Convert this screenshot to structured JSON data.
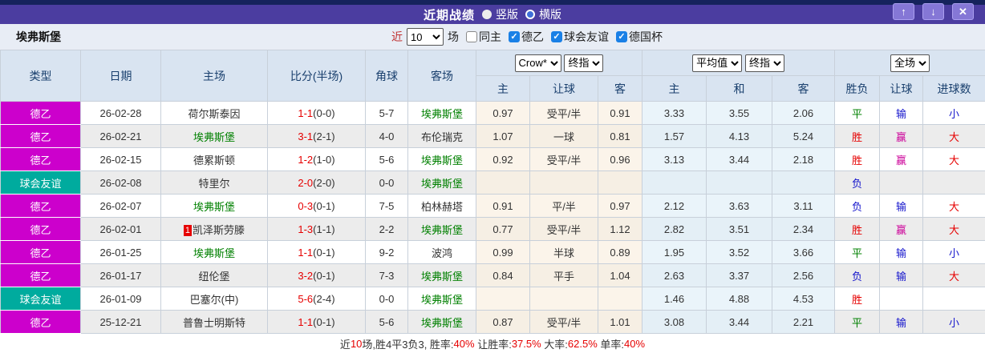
{
  "colors": {
    "red": "#e60000",
    "blue": "#1515cc",
    "green": "#008000",
    "magenta": "#cc0099",
    "badge_de2": "#cc00cc",
    "badge_friendly": "#00ab9e"
  },
  "title_bar": {
    "title": "近期战绩",
    "radio_vertical": "竖版",
    "radio_horizontal": "横版",
    "selected": "竖版",
    "buttons": {
      "up": "↑",
      "down": "↓",
      "close": "✕"
    }
  },
  "filter_bar": {
    "team": "埃弗斯堡",
    "recent_label": "近",
    "recent_value": "10",
    "games_label": "场",
    "checkboxes": [
      {
        "label": "同主",
        "checked": false
      },
      {
        "label": "德乙",
        "checked": true
      },
      {
        "label": "球会友谊",
        "checked": true
      },
      {
        "label": "德国杯",
        "checked": true
      }
    ]
  },
  "table": {
    "top_headers": [
      "类型",
      "日期",
      "主场",
      "比分(半场)",
      "角球",
      "客场"
    ],
    "sub_headers": [
      "主",
      "让球",
      "客",
      "主",
      "和",
      "客",
      "胜负",
      "让球",
      "进球数"
    ],
    "selects": {
      "handicap_company": "Crow*",
      "handicap_index": "终指",
      "odds_company": "平均值",
      "odds_index": "终指",
      "scope": "全场"
    },
    "rows": [
      {
        "type": "德乙",
        "type_key": "de2",
        "date": "26-02-28",
        "rank": "",
        "home": "荷尔斯泰因",
        "home_green": false,
        "ft": "1-1",
        "ht": "(0-0)",
        "corner": "5-7",
        "away": "埃弗斯堡",
        "away_green": true,
        "h_home": "0.97",
        "h_line": "受平/半",
        "h_away": "0.91",
        "a_home": "3.33",
        "a_draw": "3.55",
        "a_away": "2.06",
        "result": "平",
        "result_key": "green",
        "handicap": "输",
        "handicap_key": "blue",
        "goals": "小",
        "goals_key": "blue"
      },
      {
        "type": "德乙",
        "type_key": "de2",
        "date": "26-02-21",
        "rank": "",
        "home": "埃弗斯堡",
        "home_green": true,
        "ft": "3-1",
        "ht": "(2-1)",
        "corner": "4-0",
        "away": "布伦瑞克",
        "away_green": false,
        "h_home": "1.07",
        "h_line": "一球",
        "h_away": "0.81",
        "a_home": "1.57",
        "a_draw": "4.13",
        "a_away": "5.24",
        "result": "胜",
        "result_key": "red",
        "handicap": "赢",
        "handicap_key": "magenta",
        "goals": "大",
        "goals_key": "red"
      },
      {
        "type": "德乙",
        "type_key": "de2",
        "date": "26-02-15",
        "rank": "",
        "home": "德累斯顿",
        "home_green": false,
        "ft": "1-2",
        "ht": "(1-0)",
        "corner": "5-6",
        "away": "埃弗斯堡",
        "away_green": true,
        "h_home": "0.92",
        "h_line": "受平/半",
        "h_away": "0.96",
        "a_home": "3.13",
        "a_draw": "3.44",
        "a_away": "2.18",
        "result": "胜",
        "result_key": "red",
        "handicap": "赢",
        "handicap_key": "magenta",
        "goals": "大",
        "goals_key": "red"
      },
      {
        "type": "球会友谊",
        "type_key": "friendly",
        "date": "26-02-08",
        "rank": "",
        "home": "特里尔",
        "home_green": false,
        "ft": "2-0",
        "ht": "(2-0)",
        "corner": "0-0",
        "away": "埃弗斯堡",
        "away_green": true,
        "h_home": "",
        "h_line": "",
        "h_away": "",
        "a_home": "",
        "a_draw": "",
        "a_away": "",
        "result": "负",
        "result_key": "blue",
        "handicap": "",
        "handicap_key": "blue",
        "goals": "",
        "goals_key": "blue"
      },
      {
        "type": "德乙",
        "type_key": "de2",
        "date": "26-02-07",
        "rank": "",
        "home": "埃弗斯堡",
        "home_green": true,
        "ft": "0-3",
        "ht": "(0-1)",
        "corner": "7-5",
        "away": "柏林赫塔",
        "away_green": false,
        "h_home": "0.91",
        "h_line": "平/半",
        "h_away": "0.97",
        "a_home": "2.12",
        "a_draw": "3.63",
        "a_away": "3.11",
        "result": "负",
        "result_key": "blue",
        "handicap": "输",
        "handicap_key": "blue",
        "goals": "大",
        "goals_key": "red"
      },
      {
        "type": "德乙",
        "type_key": "de2",
        "date": "26-02-01",
        "rank": "1",
        "home": "凯泽斯劳滕",
        "home_green": false,
        "ft": "1-3",
        "ht": "(1-1)",
        "corner": "2-2",
        "away": "埃弗斯堡",
        "away_green": true,
        "h_home": "0.77",
        "h_line": "受平/半",
        "h_away": "1.12",
        "a_home": "2.82",
        "a_draw": "3.51",
        "a_away": "2.34",
        "result": "胜",
        "result_key": "red",
        "handicap": "赢",
        "handicap_key": "magenta",
        "goals": "大",
        "goals_key": "red"
      },
      {
        "type": "德乙",
        "type_key": "de2",
        "date": "26-01-25",
        "rank": "",
        "home": "埃弗斯堡",
        "home_green": true,
        "ft": "1-1",
        "ht": "(0-1)",
        "corner": "9-2",
        "away": "波鸿",
        "away_green": false,
        "h_home": "0.99",
        "h_line": "半球",
        "h_away": "0.89",
        "a_home": "1.95",
        "a_draw": "3.52",
        "a_away": "3.66",
        "result": "平",
        "result_key": "green",
        "handicap": "输",
        "handicap_key": "blue",
        "goals": "小",
        "goals_key": "blue"
      },
      {
        "type": "德乙",
        "type_key": "de2",
        "date": "26-01-17",
        "rank": "",
        "home": "纽伦堡",
        "home_green": false,
        "ft": "3-2",
        "ht": "(0-1)",
        "corner": "7-3",
        "away": "埃弗斯堡",
        "away_green": true,
        "h_home": "0.84",
        "h_line": "平手",
        "h_away": "1.04",
        "a_home": "2.63",
        "a_draw": "3.37",
        "a_away": "2.56",
        "result": "负",
        "result_key": "blue",
        "handicap": "输",
        "handicap_key": "blue",
        "goals": "大",
        "goals_key": "red"
      },
      {
        "type": "球会友谊",
        "type_key": "friendly",
        "date": "26-01-09",
        "rank": "",
        "home": "巴塞尔(中)",
        "home_green": false,
        "ft": "5-6",
        "ht": "(2-4)",
        "corner": "0-0",
        "away": "埃弗斯堡",
        "away_green": true,
        "h_home": "",
        "h_line": "",
        "h_away": "",
        "a_home": "1.46",
        "a_draw": "4.88",
        "a_away": "4.53",
        "result": "胜",
        "result_key": "red",
        "handicap": "",
        "handicap_key": "blue",
        "goals": "",
        "goals_key": "blue"
      },
      {
        "type": "德乙",
        "type_key": "de2",
        "date": "25-12-21",
        "rank": "",
        "home": "普鲁士明斯特",
        "home_green": false,
        "ft": "1-1",
        "ht": "(0-1)",
        "corner": "5-6",
        "away": "埃弗斯堡",
        "away_green": true,
        "h_home": "0.87",
        "h_line": "受平/半",
        "h_away": "1.01",
        "a_home": "3.08",
        "a_draw": "3.44",
        "a_away": "2.21",
        "result": "平",
        "result_key": "green",
        "handicap": "输",
        "handicap_key": "blue",
        "goals": "小",
        "goals_key": "blue"
      }
    ]
  },
  "summary": {
    "segments": [
      {
        "text": "近",
        "color": "dark"
      },
      {
        "text": "10",
        "color": "red"
      },
      {
        "text": "场,胜4平3负3, 胜率:",
        "color": "dark"
      },
      {
        "text": "40%",
        "color": "red"
      },
      {
        "text": " 让胜率:",
        "color": "dark"
      },
      {
        "text": "37.5%",
        "color": "red"
      },
      {
        "text": " 大率:",
        "color": "dark"
      },
      {
        "text": "62.5%",
        "color": "red"
      },
      {
        "text": " 单率:",
        "color": "dark"
      },
      {
        "text": "40%",
        "color": "red"
      }
    ]
  }
}
